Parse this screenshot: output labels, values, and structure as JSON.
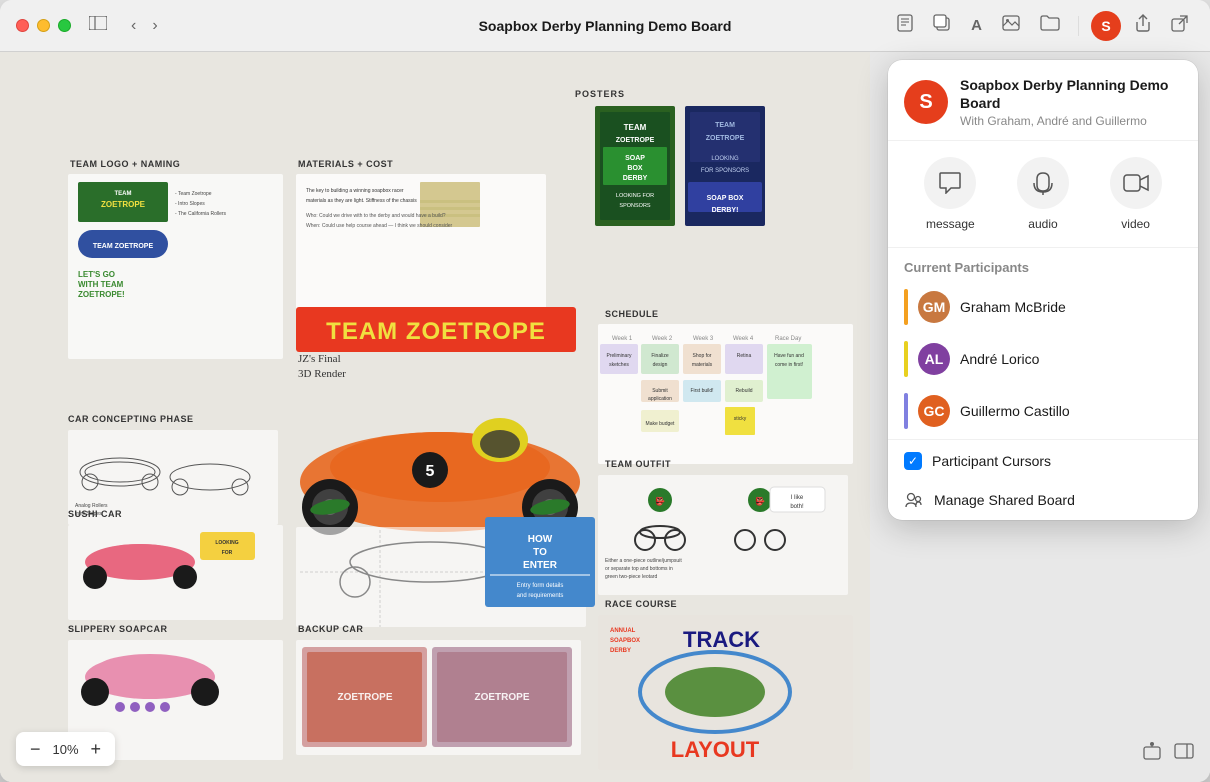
{
  "window": {
    "title": "Soapbox Derby Planning Demo Board"
  },
  "titlebar": {
    "back_label": "‹",
    "forward_label": "›",
    "title": "Soapbox Derby Planning Demo Board",
    "traffic_lights": [
      "red",
      "yellow",
      "green"
    ]
  },
  "toolbar_icons": {
    "sidebar": "⬛",
    "back": "‹",
    "forward": "›",
    "document": "☰",
    "copy": "⧉",
    "text": "A",
    "image": "🖼",
    "folder": "📁",
    "share": "⬆",
    "external": "⬡"
  },
  "popover": {
    "board_title": "Soapbox Derby Planning Demo Board",
    "board_subtitle": "With Graham, André and Guillermo",
    "avatar_letter": "S",
    "actions": [
      {
        "id": "message",
        "icon": "💬",
        "label": "message"
      },
      {
        "id": "audio",
        "icon": "📞",
        "label": "audio"
      },
      {
        "id": "video",
        "icon": "🎥",
        "label": "video"
      }
    ],
    "section_title": "Current Participants",
    "participants": [
      {
        "name": "Graham McBride",
        "color": "#f4a020",
        "avatar_color": "#c87840",
        "initials": "GM"
      },
      {
        "name": "André Lorico",
        "color": "#e8d020",
        "avatar_color": "#8040a0",
        "initials": "AL"
      },
      {
        "name": "Guillermo Castillo",
        "color": "#8080e0",
        "avatar_color": "#e06020",
        "initials": "GC"
      }
    ],
    "menu_items": [
      {
        "id": "participant-cursors",
        "label": "Participant Cursors",
        "has_checkbox": true,
        "checked": true
      },
      {
        "id": "manage-shared-board",
        "label": "Manage Shared Board",
        "icon": "👥"
      }
    ]
  },
  "zoom": {
    "value": "10%",
    "minus_label": "−",
    "plus_label": "+"
  },
  "board_sections": {
    "posters_label": "POSTERS",
    "schedule_label": "SCHEDULE",
    "team_outfit_label": "TEAM OUTFIT",
    "race_course_label": "RACE COURSE",
    "team_logo_label": "TEAM LOGO + NAMING",
    "materials_label": "MATERIALS & COST",
    "car_concepting_label": "CAR CONCEPTING PHASE",
    "sushi_car_label": "SUSHI CAR",
    "slippery_label": "SLIPPERY SOAPCAR",
    "backup_car_label": "BACKUP CAR"
  }
}
